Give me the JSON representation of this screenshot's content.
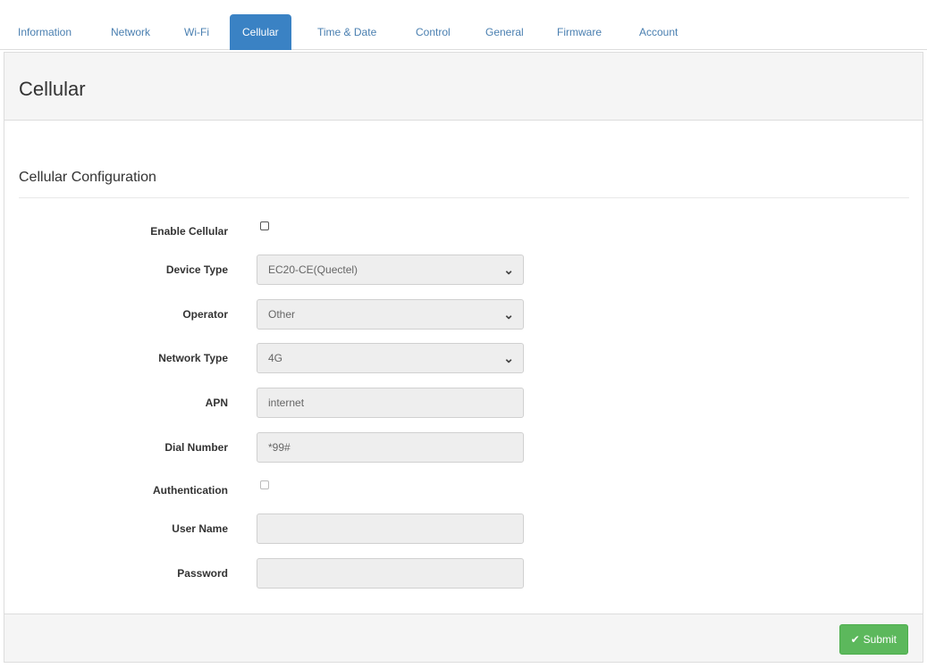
{
  "tabs": [
    {
      "label": "Information"
    },
    {
      "label": "Network"
    },
    {
      "label": "Wi-Fi"
    },
    {
      "label": "Cellular",
      "active": true
    },
    {
      "label": "Time & Date"
    },
    {
      "label": "Control"
    },
    {
      "label": "General"
    },
    {
      "label": "Firmware"
    },
    {
      "label": "Account"
    }
  ],
  "panel": {
    "title": "Cellular",
    "section_title": "Cellular Configuration"
  },
  "form": {
    "enable_cellular": {
      "label": "Enable Cellular",
      "checked": false
    },
    "device_type": {
      "label": "Device Type",
      "value": "EC20-CE(Quectel)"
    },
    "operator": {
      "label": "Operator",
      "value": "Other"
    },
    "network_type": {
      "label": "Network Type",
      "value": "4G"
    },
    "apn": {
      "label": "APN",
      "value": "internet"
    },
    "dial_number": {
      "label": "Dial Number",
      "value": "*99#"
    },
    "authentication": {
      "label": "Authentication",
      "checked": false
    },
    "user_name": {
      "label": "User Name",
      "value": ""
    },
    "password": {
      "label": "Password",
      "value": ""
    }
  },
  "footer": {
    "submit_label": "Submit"
  },
  "icons": {
    "chevron": "chevron-down-icon",
    "check": "check-icon"
  },
  "colors": {
    "active_tab": "#3a82c4",
    "tab_text": "#4a7fb0",
    "submit": "#5cb85c"
  }
}
